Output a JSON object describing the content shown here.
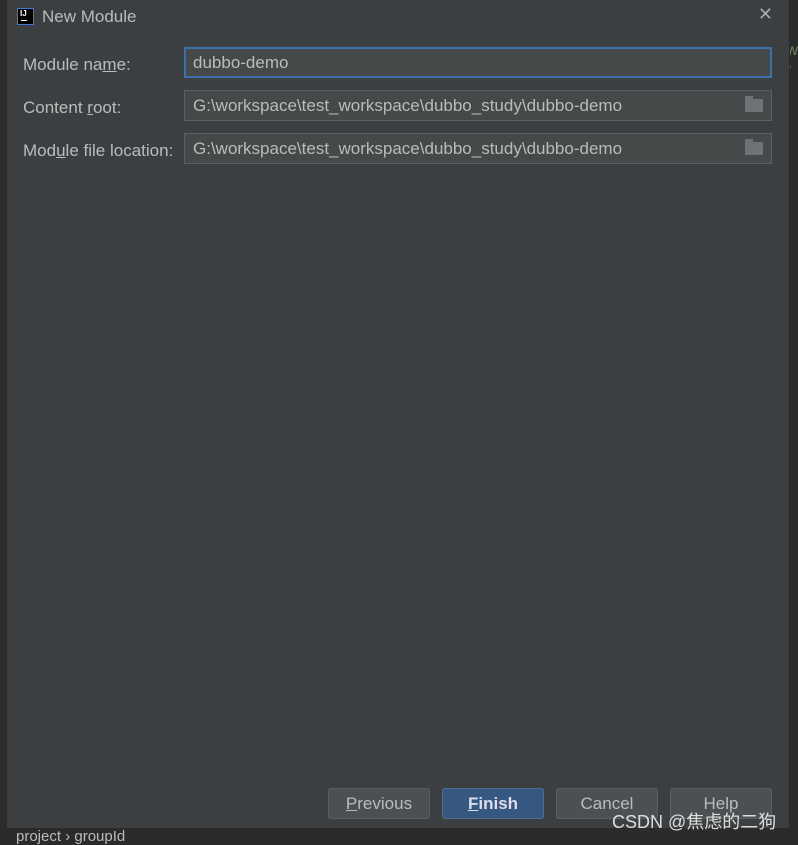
{
  "dialog": {
    "title": "New Module",
    "close_icon": "close-icon"
  },
  "form": {
    "module_name": {
      "label_pre": "Module na",
      "label_mn": "m",
      "label_post": "e:",
      "value": "dubbo-demo"
    },
    "content_root": {
      "label_pre": "Content ",
      "label_mn": "r",
      "label_post": "oot:",
      "value": "G:\\workspace\\test_workspace\\dubbo_study\\dubbo-demo"
    },
    "module_file_location": {
      "label_pre": "Mod",
      "label_mn": "u",
      "label_post": "le file location:",
      "value": "G:\\workspace\\test_workspace\\dubbo_study\\dubbo-demo"
    }
  },
  "buttons": {
    "previous": {
      "mn": "P",
      "rest": "revious"
    },
    "finish": {
      "mn": "F",
      "rest": "inish"
    },
    "cancel": "Cancel",
    "help": "Help"
  },
  "background": {
    "bottom_text": "project  ›  groupId",
    "side_text": "w\n/"
  },
  "watermark": "CSDN @焦虑的二狗",
  "colors": {
    "accent": "#365880",
    "focus_border": "#3d6fa8",
    "dialog_bg": "#3c3f41"
  }
}
